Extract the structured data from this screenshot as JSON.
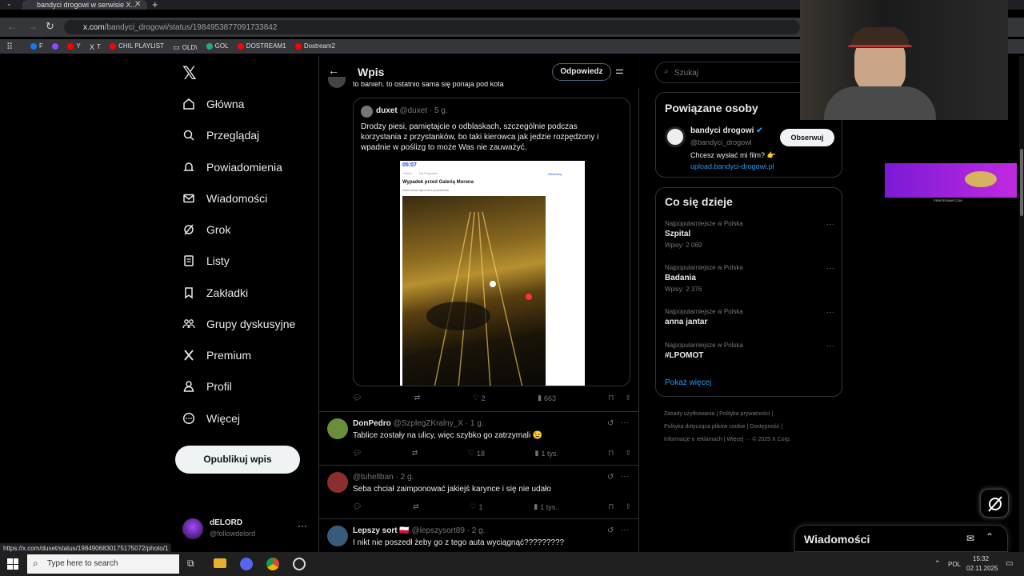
{
  "browser": {
    "tab_title": "bandyci drogowi w serwisie X...",
    "url_prefix": "x.com",
    "url_path": "/bandyci_drogowi/status/1984953877091733842",
    "bookmarks": [
      "F",
      "Y",
      "T",
      "CHIL PLAYLIST",
      "OLD\\",
      "GOL",
      "DOSTREAM1",
      "Dostream2"
    ],
    "status_url": "https://x.com/duxet/status/1984906830175175072/photo/1"
  },
  "nav": {
    "items": [
      "Główna",
      "Przeglądaj",
      "Powiadomienia",
      "Wiadomości",
      "Grok",
      "Listy",
      "Zakładki",
      "Grupy dyskusyjne",
      "Premium",
      "Profil",
      "Więcej"
    ],
    "post_button": "Opublikuj wpis",
    "user_name": "dELORD",
    "user_handle": "@followdelord"
  },
  "header": {
    "title": "Wpis",
    "reply_button": "Odpowiedz",
    "top_clipped_text": "to banieh. to ostatnio sama się ponaja pod kota"
  },
  "quoted": {
    "name": "duxet",
    "handle": "@duxet",
    "time": "5 g.",
    "text": "Drodzy piesi, pamiętajcie o odblaskach, szczególnie podczas korzystania z przystanków, bo taki kierowca jak jedzie rozpędzony i wpadnie w poślizg to może Was nie zauważyć.",
    "screenshot_time": "05:07",
    "screenshot_title": "Wypadek przed Galerią Morena",
    "screenshot_sub": "Samochód wjechał w przystanek",
    "screenshot_follow": "Obserwuj",
    "screenshot_tags": [
      "Home",
      "Na Pogodzie"
    ]
  },
  "main_actions": {
    "likes": "2",
    "views": "663"
  },
  "replies": [
    {
      "name": "DonPedro",
      "handle": "@SzplegZKralny_X",
      "time": "1 g.",
      "text": "Tablice zostały na ulicy, więc szybko go zatrzymali 😉",
      "likes": "18",
      "views": "1 tys."
    },
    {
      "name": "",
      "handle": "@tuhellban",
      "time": "2 g.",
      "text": "Seba chciał zaimponować jakiejś karynce i się nie udało",
      "likes": "1",
      "views": "1 tys."
    },
    {
      "name": "Lepszy sort 🇵🇱",
      "handle": "@lepszysort89",
      "time": "2 g.",
      "text": "I nikt nie poszedł żeby go z tego auta wyciągnąć?????????",
      "likes": "",
      "views": ""
    }
  ],
  "right": {
    "search_placeholder": "Szukaj",
    "related_title": "Powiązane osoby",
    "related_name": "bandyci drogowi",
    "related_handle": "@bandyci_drogowl",
    "related_follow": "Obserwuj",
    "related_bio": "Chcesz wysłać mi film? 👉",
    "related_link": "upload.bandyci-drogowi.pl",
    "trends_title": "Co się dzieje",
    "trends": [
      {
        "cat": "Najpopularniejsze w Polska",
        "title": "Szpital",
        "count": "Wpisy: 2 069"
      },
      {
        "cat": "Najpopularniejsze w Polska",
        "title": "Badania",
        "count": "Wpisy: 2 376"
      },
      {
        "cat": "Najpopularniejsze w Polska",
        "title": "anna jantar",
        "count": ""
      },
      {
        "cat": "Najpopularniejsze w Polska",
        "title": "#LPOMOT",
        "count": ""
      }
    ],
    "show_more": "Pokaż więcej",
    "footer": [
      "Zasady użytkowania",
      "Polityka prywatności",
      "Polityka dotycząca plików cookie",
      "Dostępność",
      "Informacje o reklamach",
      "Więcej ···",
      "© 2025 X Corp."
    ],
    "messages_label": "Wiadomości",
    "ad_text": "PIRATESWAP.COM"
  },
  "taskbar": {
    "search_placeholder": "Type here to search",
    "lang": "POL",
    "time": "15:32",
    "date": "02.11.2025"
  }
}
